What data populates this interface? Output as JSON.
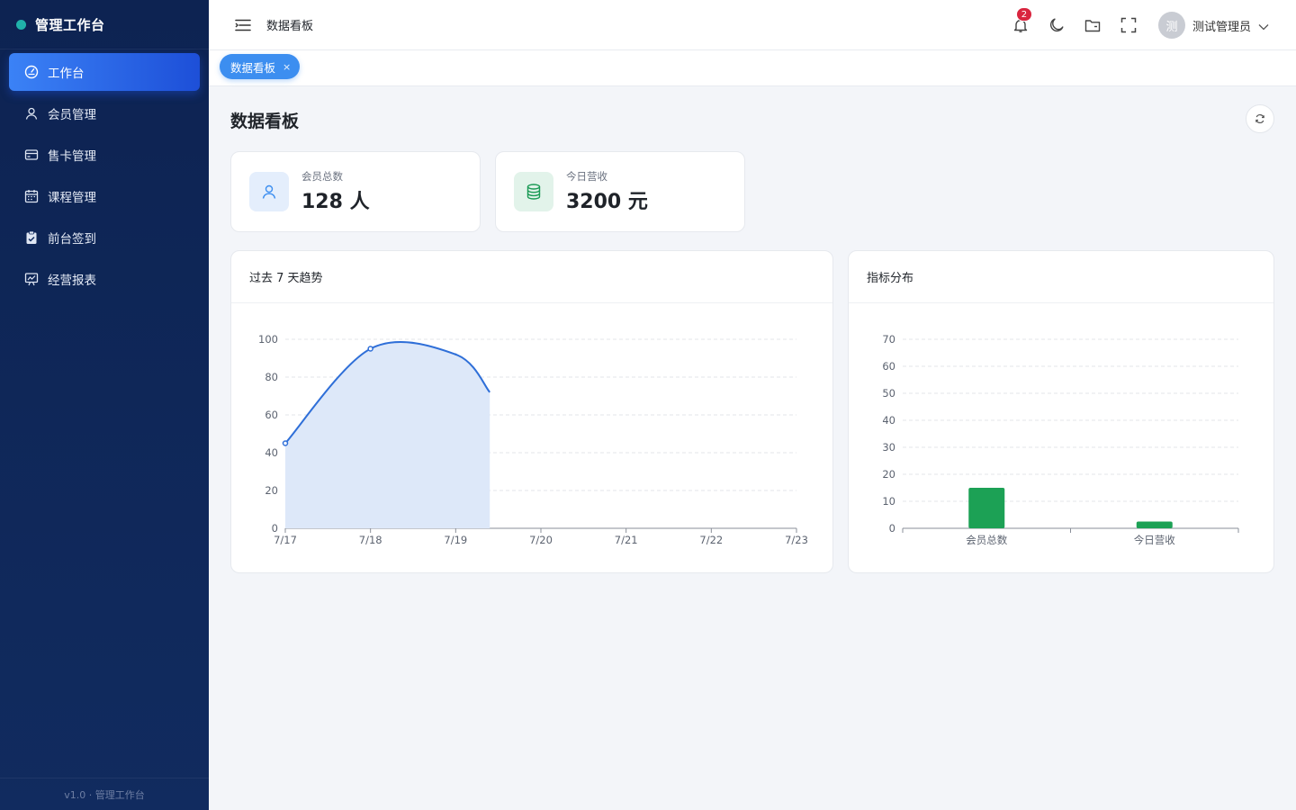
{
  "brand": {
    "title": "管理工作台"
  },
  "sidebar": {
    "items": [
      {
        "label": "工作台",
        "icon": "dashboard-icon",
        "active": true
      },
      {
        "label": "会员管理",
        "icon": "user-icon",
        "active": false
      },
      {
        "label": "售卡管理",
        "icon": "card-icon",
        "active": false
      },
      {
        "label": "课程管理",
        "icon": "calendar-icon",
        "active": false
      },
      {
        "label": "前台签到",
        "icon": "clipboard-check-icon",
        "active": false
      },
      {
        "label": "经营报表",
        "icon": "chart-board-icon",
        "active": false
      }
    ],
    "footer": "v1.0 · 管理工作台"
  },
  "header": {
    "title": "数据看板",
    "notification_count": "2",
    "user": {
      "avatar_text": "测",
      "name": "测试管理员"
    }
  },
  "tabs": [
    {
      "label": "数据看板",
      "close": "×"
    }
  ],
  "page": {
    "title": "数据看板"
  },
  "stats": [
    {
      "label": "会员总数",
      "value": "128 人",
      "icon": "user-icon",
      "color": "#3c8ef0"
    },
    {
      "label": "今日营收",
      "value": "3200 元",
      "icon": "database-icon",
      "color": "#1a9a55"
    }
  ],
  "panels": {
    "trend_title": "过去 7 天趋势",
    "dist_title": "指标分布"
  },
  "colors": {
    "accent": "#2f6fd8",
    "area": "#dde8f9",
    "bar": "#1ca155"
  },
  "chart_data": [
    {
      "type": "area",
      "x": [
        "7/17",
        "7/18",
        "7/19",
        "7/20",
        "7/21",
        "7/22",
        "7/23"
      ],
      "series": [
        {
          "values": [
            45,
            95,
            92,
            72
          ]
        }
      ],
      "ylim": [
        0,
        100
      ],
      "yticks": [
        0,
        20,
        40,
        60,
        80,
        100
      ],
      "grid": true
    },
    {
      "type": "bar",
      "categories": [
        "会员总数",
        "今日营收"
      ],
      "values": [
        15,
        2.5
      ],
      "ylim": [
        0,
        70
      ],
      "yticks": [
        0,
        10,
        20,
        30,
        40,
        50,
        60,
        70
      ],
      "grid": true
    }
  ]
}
